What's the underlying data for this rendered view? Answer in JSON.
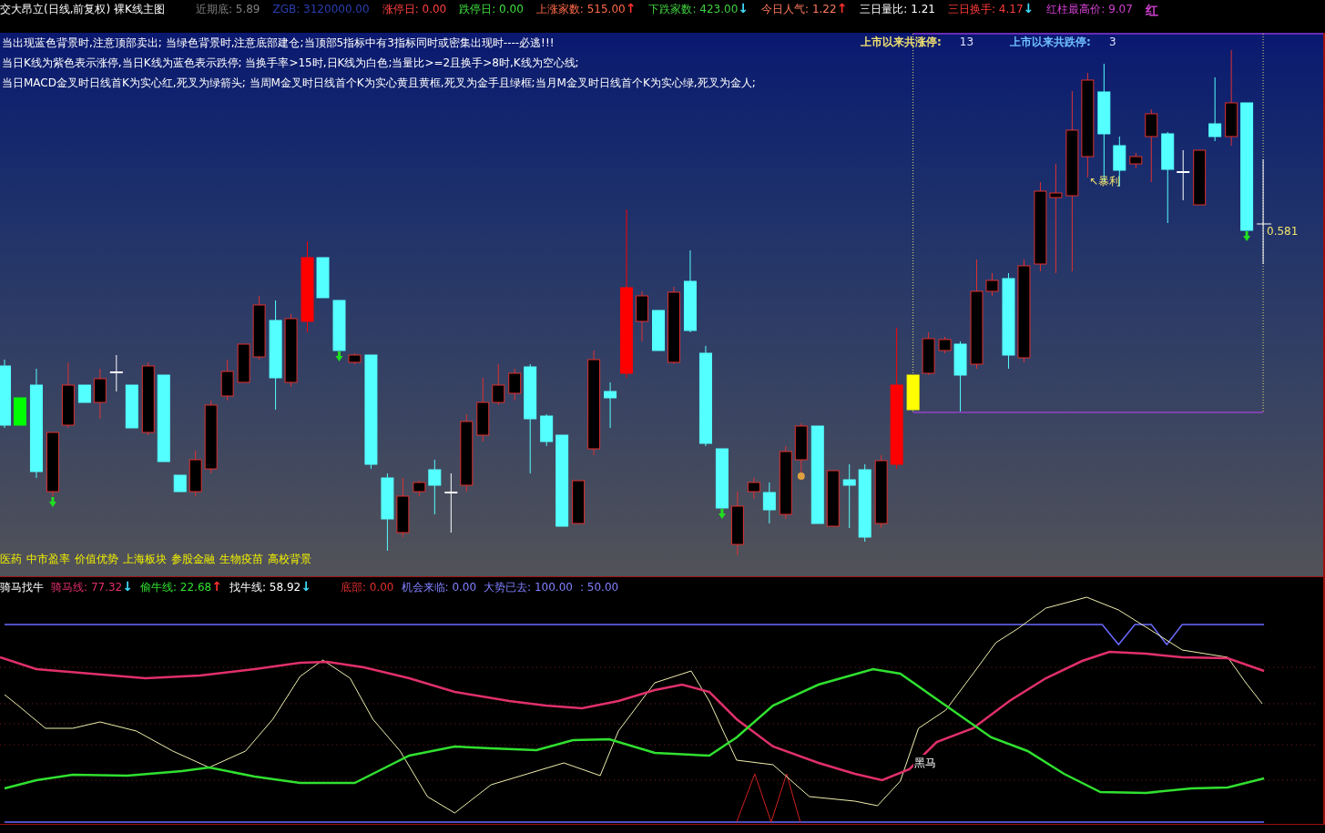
{
  "header": {
    "title": "交大昂立(日线,前复权) 裸K线主图",
    "items": [
      {
        "label": "近期底:",
        "value": "5.89",
        "color": "#808080"
      },
      {
        "label": "ZGB:",
        "value": "3120000.00",
        "color": "#2a3fb0"
      },
      {
        "label": "涨停日:",
        "value": "0.00",
        "color": "#ff4040"
      },
      {
        "label": "跌停日:",
        "value": "0.00",
        "color": "#40e040"
      },
      {
        "label": "上涨家数:",
        "value": "515.00",
        "color": "#ff6a4a",
        "arrow": {
          "text": "↑",
          "color": "#ff3030"
        }
      },
      {
        "label": "下跌家数:",
        "value": "423.00",
        "color": "#40d040",
        "arrow": {
          "text": "↓",
          "color": "#40e0ff"
        }
      },
      {
        "label": "今日人气:",
        "value": "1.22",
        "color": "#ff7a60",
        "arrow": {
          "text": "↑",
          "color": "#ff3030"
        }
      },
      {
        "label": "三日量比:",
        "value": "1.21",
        "color": "#ffffff"
      },
      {
        "label": "三日换手:",
        "value": "4.17",
        "color": "#ff3a3a",
        "arrow": {
          "text": "↓",
          "color": "#40e0ff"
        }
      },
      {
        "label": "红柱最高价:",
        "value": "9.07",
        "color": "#d040d0"
      },
      {
        "label": "红",
        "color": "#d040d0"
      }
    ]
  },
  "main_chart": {
    "notes": [
      "当出现蓝色背景时,注意顶部卖出; 当绿色背景时,注意底部建仓;当顶部5指标中有3指标同时或密集出现时----必逃!!!",
      "当日K线为紫色表示涨停,当日K线为蓝色表示跌停; 当换手率>15时,日K线为白色;当量比>=2且换手>8时,K线为空心线;",
      "当日MACD金叉时日线首K为实心红,死叉为绿箭头; 当周M金叉时日线首个K为实心黄且黄框,死叉为金手且绿框;当月M金叉时日线首个K为实心绿,死叉为金人;"
    ],
    "stats": [
      {
        "label": "上市以来共涨停:",
        "value": "13",
        "color": "#f0e070"
      },
      {
        "label": "上市以来共跌停:",
        "value": "3",
        "color": "#70c0ff"
      }
    ],
    "annotations": [
      {
        "kind": "tag",
        "text": "↖暴利"
      },
      {
        "kind": "price",
        "text": "0.581"
      }
    ],
    "sectors": [
      "医药",
      "中市盈率",
      "价值优势",
      "上海板块",
      "参股金融",
      "生物疫苗",
      "高校背景"
    ]
  },
  "indicator": {
    "title": "骑马找牛",
    "lines": [
      {
        "label": "骑马线:",
        "value": "77.32",
        "color": "#e0306a",
        "arrow": {
          "text": "↓",
          "color": "#40e0ff"
        }
      },
      {
        "label": "偷牛线:",
        "value": "22.68",
        "color": "#30e030",
        "arrow": {
          "text": "↑",
          "color": "#ff3030"
        }
      },
      {
        "label": "找牛线:",
        "value": "58.92",
        "color": "#ffffff",
        "arrow": {
          "text": "↓",
          "color": "#40e0ff"
        }
      },
      {
        "label": "底部:",
        "value": "0.00",
        "color": "#e03030"
      },
      {
        "label": "机会来临:",
        "value": "0.00",
        "color": "#8080ff"
      },
      {
        "label": "大势已去:",
        "value": "100.00",
        "color": "#8080ff"
      },
      {
        "value": ": 50.00",
        "color": "#8080ff"
      }
    ],
    "annotation": "黑马"
  }
}
